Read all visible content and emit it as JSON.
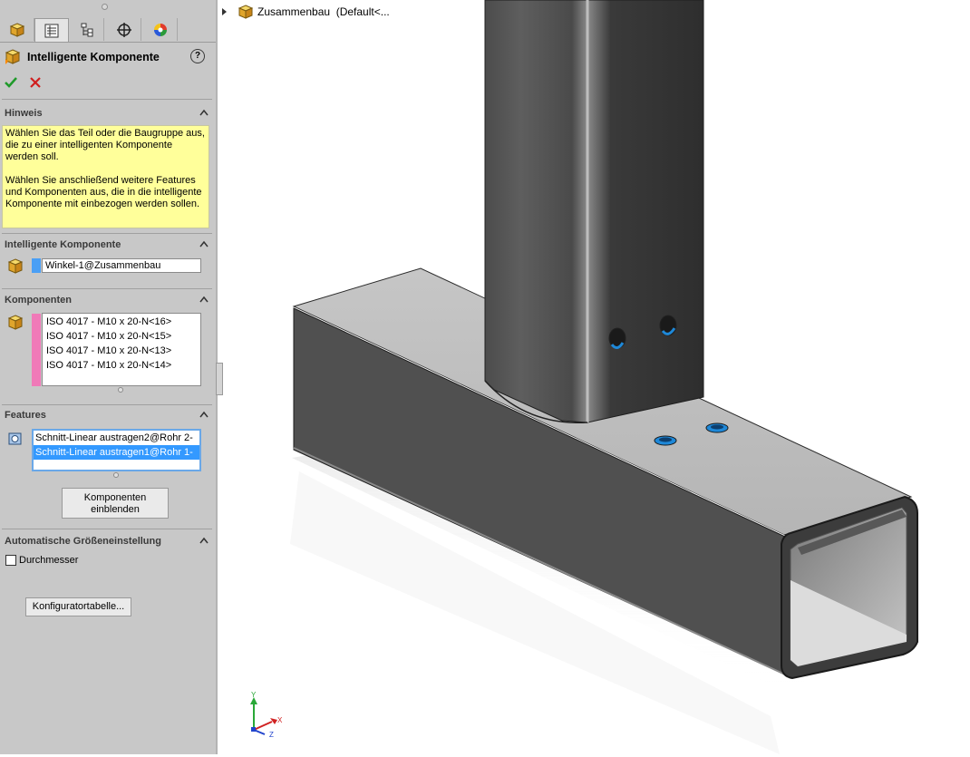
{
  "tabs": [
    {
      "name": "feature-manager-tab",
      "icon": "part-cube-icon"
    },
    {
      "name": "property-manager-tab",
      "icon": "property-list-icon"
    },
    {
      "name": "configuration-manager-tab",
      "icon": "configuration-tree-icon"
    },
    {
      "name": "dimxpert-tab",
      "icon": "crosshair-icon"
    },
    {
      "name": "display-manager-tab",
      "icon": "color-wheel-icon"
    }
  ],
  "panel": {
    "title": "Intelligente Komponente",
    "help_label": "?",
    "ok_icon": "checkmark-icon",
    "cancel_icon": "close-icon"
  },
  "hint": {
    "header": "Hinweis",
    "paragraph1": "Wählen Sie das Teil oder die Baugruppe aus, die zu einer intelligenten Komponente werden soll.",
    "paragraph2": "Wählen Sie anschließend weitere Features und Komponenten aus, die in die intelligente Komponente mit einbezogen werden sollen."
  },
  "smart_component": {
    "header": "Intelligente Komponente",
    "value": "Winkel-1@Zusammenbau",
    "color": "#4a9ff5"
  },
  "components": {
    "header": "Komponenten",
    "color": "#f07ab8",
    "items": [
      "ISO 4017 - M10 x 20-N<16>",
      "ISO 4017 - M10 x 20-N<15>",
      "ISO 4017 - M10 x 20-N<13>",
      "ISO 4017 - M10 x 20-N<14>"
    ]
  },
  "features": {
    "header": "Features",
    "items": [
      "Schnitt-Linear austragen2@Rohr 2-",
      "Schnitt-Linear austragen1@Rohr 1-"
    ],
    "selected_index": 1,
    "show_components_button": "Komponenten einblenden"
  },
  "auto_size": {
    "header": "Automatische Größeneinstellung",
    "checkbox_label": "Durchmesser",
    "checked": false
  },
  "config_table_button": "Konfiguratortabelle...",
  "tree": {
    "root_label": "Zusammenbau  (Default<..."
  },
  "triad": {
    "x": "X",
    "y": "Y",
    "z": "Z"
  },
  "colors": {
    "panel_bg": "#c8c8c8",
    "hint_bg": "#ffff9a",
    "selection": "#3399ff",
    "hole_blue": "#1e88d8"
  }
}
